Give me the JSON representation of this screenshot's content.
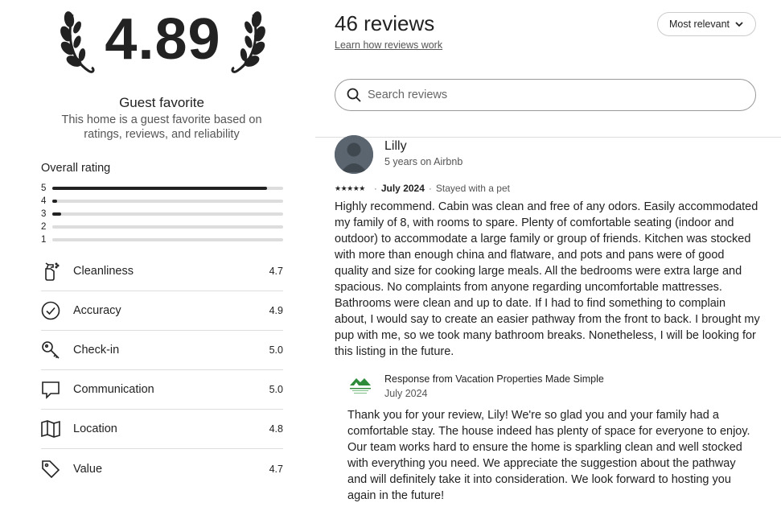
{
  "rating": {
    "score": "4.89",
    "badge": "Guest favorite",
    "description": "This home is a guest favorite based on ratings, reviews, and reliability"
  },
  "overall": {
    "title": "Overall rating",
    "distribution": [
      {
        "stars": "5",
        "fraction": 0.93
      },
      {
        "stars": "4",
        "fraction": 0.02
      },
      {
        "stars": "3",
        "fraction": 0.04
      },
      {
        "stars": "2",
        "fraction": 0.0
      },
      {
        "stars": "1",
        "fraction": 0.0
      }
    ]
  },
  "categories": [
    {
      "label": "Cleanliness",
      "value": "4.7",
      "icon": "spray-bottle-icon"
    },
    {
      "label": "Accuracy",
      "value": "4.9",
      "icon": "check-circle-icon"
    },
    {
      "label": "Check-in",
      "value": "5.0",
      "icon": "key-icon"
    },
    {
      "label": "Communication",
      "value": "5.0",
      "icon": "chat-bubble-icon"
    },
    {
      "label": "Location",
      "value": "4.8",
      "icon": "map-icon"
    },
    {
      "label": "Value",
      "value": "4.7",
      "icon": "tag-icon"
    }
  ],
  "reviews_header": {
    "count": "46 reviews",
    "learn_link": "Learn how reviews work",
    "sort_label": "Most relevant",
    "search_placeholder": "Search reviews"
  },
  "review": {
    "name": "Lilly",
    "meta": "5 years on Airbnb",
    "stars": "★★★★★",
    "date": "July 2024",
    "trip": "Stayed with a pet",
    "text": "Highly recommend. Cabin was clean and free of any odors. Easily accommodated my family of 8, with rooms to spare. Plenty of comfortable seating (indoor and outdoor) to accommodate a large family or group of friends. Kitchen was stocked with more than enough china and flatware, and pots and pans were of good quality and size for cooking large meals. All the bedrooms were extra large and spacious. No complaints from anyone regarding uncomfortable mattresses. Bathrooms were clean and up to date. If I had to find something to complain about, I would say to create an easier pathway from the front to back. I brought my pup with me, so we took many bathroom breaks. Nonetheless, I will be looking for this listing in the future."
  },
  "response": {
    "title": "Response from Vacation Properties Made Simple",
    "date": "July 2024",
    "text": "Thank you for your review, Lily! We're so glad you and your family had a comfortable stay. The house indeed has plenty of space for everyone to enjoy. Our team works hard to ensure the home is sparkling clean and well stocked with everything you need. We appreciate the suggestion about the pathway and will definitely take it into consideration. We look forward to hosting you again in the future!"
  },
  "colors": {
    "text": "#222222",
    "muted": "#555555",
    "divider": "#dddddd",
    "bar_track": "#dddddd",
    "bar_fill": "#222222",
    "host_green": "#2e8b3a"
  }
}
